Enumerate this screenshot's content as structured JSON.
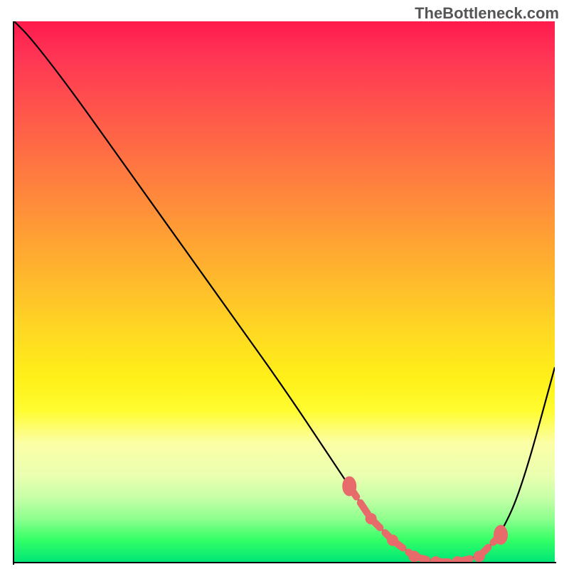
{
  "watermark": "TheBottleneck.com",
  "colors": {
    "gradient_top": "#ff1a4d",
    "gradient_bottom": "#00e676",
    "curve": "#000000",
    "markers": "#e86b6b"
  },
  "chart_data": {
    "type": "line",
    "title": "",
    "xlabel": "",
    "ylabel": "",
    "xlim": [
      0,
      100
    ],
    "ylim": [
      0,
      100
    ],
    "series": [
      {
        "name": "bottleneck-curve",
        "x": [
          0,
          3,
          10,
          20,
          30,
          40,
          50,
          58,
          62,
          66,
          70,
          74,
          78,
          82,
          86,
          90,
          94,
          100
        ],
        "y": [
          100,
          97,
          88,
          74,
          60,
          46,
          32,
          20,
          14,
          8,
          4,
          1,
          0,
          0,
          1,
          5,
          14,
          36
        ]
      }
    ],
    "markers": {
      "name": "optimal-zone",
      "x": [
        62,
        66,
        70,
        74,
        78,
        82,
        86,
        90
      ],
      "y": [
        14,
        8,
        4,
        1,
        0,
        0,
        1,
        5
      ]
    }
  }
}
